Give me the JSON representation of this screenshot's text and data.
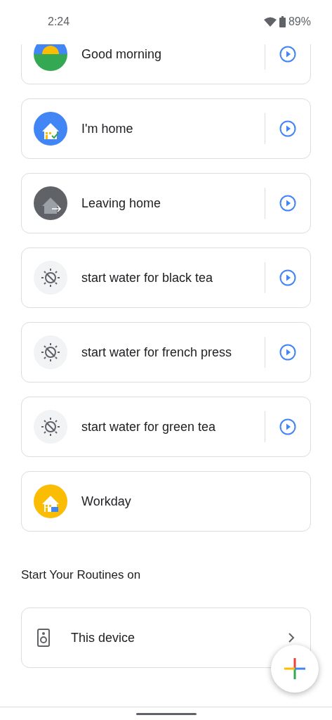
{
  "status_bar": {
    "time": "2:24",
    "battery": "89%"
  },
  "routines": [
    {
      "name": "Good morning",
      "kind": "sunrise",
      "has_play": true
    },
    {
      "name": "I'm home",
      "kind": "arriving",
      "has_play": true
    },
    {
      "name": "Leaving home",
      "kind": "leaving",
      "has_play": true
    },
    {
      "name": "start water for black tea",
      "kind": "custom",
      "has_play": true
    },
    {
      "name": "start water for french press",
      "kind": "custom",
      "has_play": true
    },
    {
      "name": "start water for green tea",
      "kind": "custom",
      "has_play": true
    },
    {
      "name": "Workday",
      "kind": "work",
      "has_play": false
    }
  ],
  "start_section": {
    "heading": "Start Your Routines on",
    "device": "This device"
  }
}
